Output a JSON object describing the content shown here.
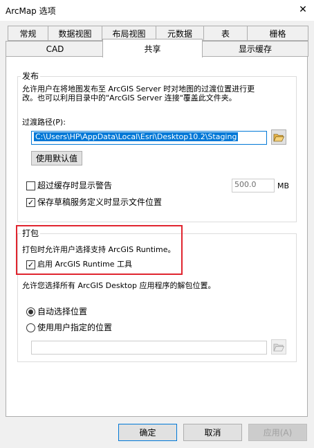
{
  "window": {
    "title": "ArcMap 选项",
    "close_glyph": "✕"
  },
  "tabs_row1": [
    {
      "label": "常规"
    },
    {
      "label": "数据视图"
    },
    {
      "label": "布局视图"
    },
    {
      "label": "元数据"
    },
    {
      "label": "表"
    },
    {
      "label": "栅格"
    }
  ],
  "tabs_row2": [
    {
      "label": "CAD"
    },
    {
      "label": "共享",
      "active": true
    },
    {
      "label": "显示缓存"
    }
  ],
  "publish": {
    "legend": "发布",
    "desc_line1": "允许用户在将地图发布至 ArcGIS Server 时对地图的过渡位置进行更",
    "desc_line2": "改。也可以利用目录中的\"ArcGIS Server 连接\"覆盖此文件夹。",
    "staging_label": "过渡路径(P):",
    "staging_value": "C:\\Users\\HP\\AppData\\Local\\Esri\\Desktop10.2\\Staging",
    "use_default_label": "使用默认值",
    "cache_warning_label": "超过缓存时显示警告",
    "cache_warning_checked": false,
    "cache_size_value": "500.0",
    "cache_unit": "MB",
    "save_draft_label": "保存草稿服务定义时显示文件位置",
    "save_draft_checked": true
  },
  "package": {
    "legend": "打包",
    "desc": "打包时允许用户选择支持 ArcGIS Runtime。",
    "enable_runtime_label": "启用 ArcGIS Runtime 工具",
    "enable_runtime_checked": true,
    "unpack_desc": "允许您选择所有 ArcGIS Desktop 应用程序的解包位置。",
    "auto_location_label": "自动选择位置",
    "auto_location_selected": true,
    "user_location_label": "使用用户指定的位置",
    "user_location_selected": false,
    "user_location_value": ""
  },
  "footer": {
    "ok_label": "确定",
    "cancel_label": "取消",
    "apply_label": "应用(A)"
  },
  "colors": {
    "accent": "#0078d7",
    "highlight_box": "#e0242e",
    "folder_icon": "#e8b54a"
  }
}
